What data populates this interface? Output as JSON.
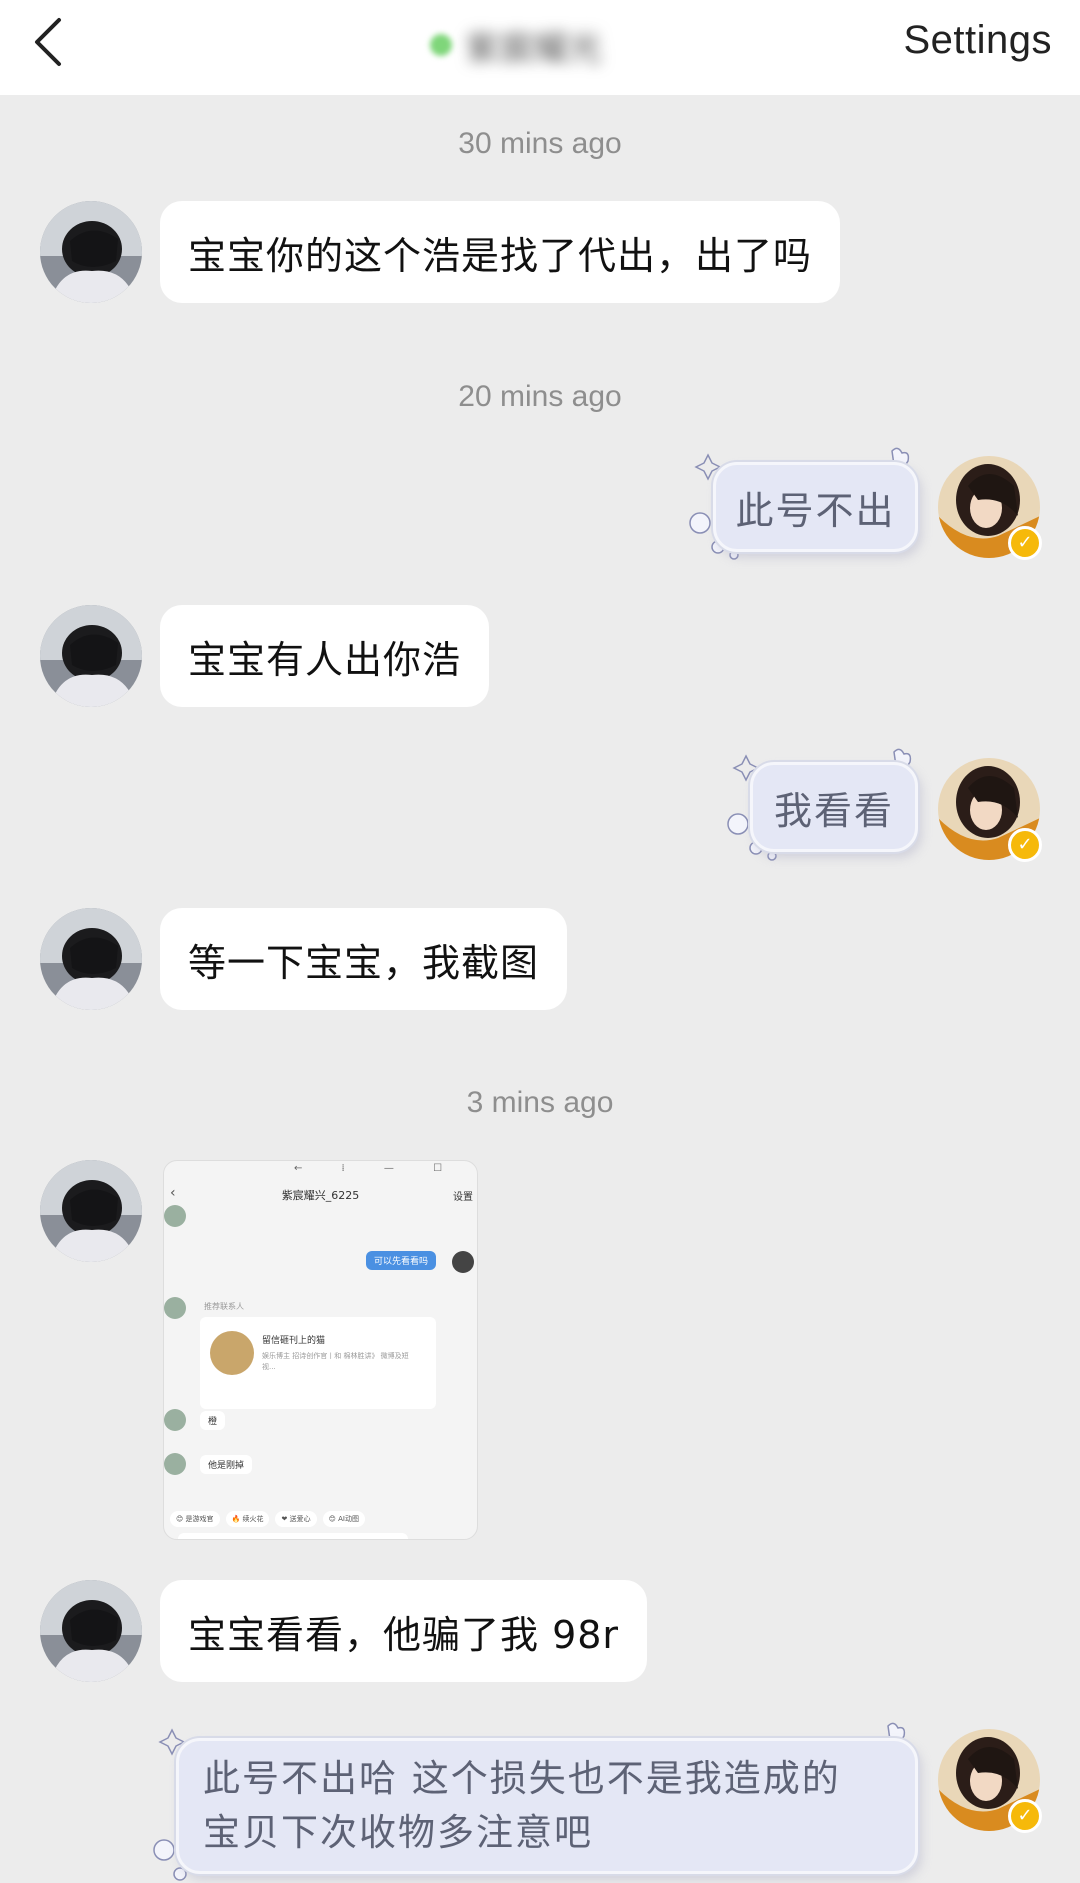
{
  "header": {
    "back_icon": "chevron-left-icon",
    "peer_name": "紫宸耀光",
    "online_color": "#7fd67a",
    "settings_label": "Settings"
  },
  "timestamps": [
    "30 mins ago",
    "20 mins ago",
    "3 mins ago"
  ],
  "messages": [
    {
      "side": "in",
      "text": "宝宝你的这个浩是找了代出，出了吗"
    },
    {
      "side": "out",
      "text": "此号不出"
    },
    {
      "side": "in",
      "text": "宝宝有人出你浩"
    },
    {
      "side": "out",
      "text": "我看看"
    },
    {
      "side": "in",
      "text": "等一下宝宝，我截图"
    },
    {
      "side": "in",
      "type": "image"
    },
    {
      "side": "in",
      "text": "宝宝看看，他骗了我 98r"
    },
    {
      "side": "out",
      "lines": [
        "此号不出哈  这个损失也不是我造成的",
        "宝贝下次收物多注意吧"
      ]
    }
  ],
  "screenshot_image": {
    "title": "紫宸耀兴_6225",
    "settings": "设置",
    "blue_message": "可以先看看吗",
    "recommend_label": "推荐联系人",
    "card_name": "留信砸刊上的猫",
    "card_desc": "娱乐博主 招诗创作官丨和 棉林胜讲》 微博及短视...",
    "reply_1": "橙",
    "reply_2": "他是刚掉",
    "chips": [
      "😊 是游戏官",
      "🔥 续火花",
      "❤ 送爱心",
      "😊 AI动图"
    ]
  },
  "colors": {
    "background": "#ececec",
    "incoming_bubble": "#ffffff",
    "outgoing_bubble": "#e4e7f5",
    "badge": "#f6b90a"
  }
}
